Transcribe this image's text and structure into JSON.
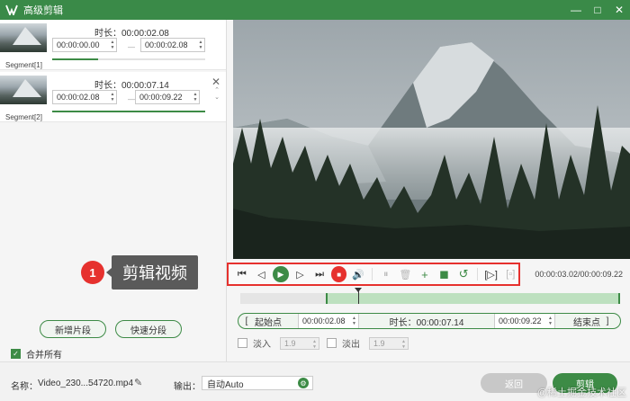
{
  "window": {
    "title": "高级剪辑",
    "minimize": "—",
    "maximize": "□",
    "close": "✕"
  },
  "segments": [
    {
      "label": "Segment[1]",
      "duration": "时长：00:00:02.08",
      "start": "00:00:00.00",
      "end": "00:00:02.08",
      "progress": 0.3,
      "dash": "—"
    },
    {
      "label": "Segment[2]",
      "duration": "时长：00:00:07.14",
      "start": "00:00:02.08",
      "end": "00:00:09.22",
      "progress": 1.0,
      "dash": "—",
      "close": "✕"
    }
  ],
  "annotation": {
    "number": "1",
    "text": "剪辑视频"
  },
  "left_buttons": {
    "add_segment": "新增片段",
    "quick_split": "快速分段"
  },
  "merge_all": {
    "label": "合并所有",
    "checked": true
  },
  "player": {
    "timecode": "00:00:03.02/00:00:09.22"
  },
  "range": {
    "start_label": "起始点",
    "start_value": "00:00:02.08",
    "duration": "时长：00:00:07.14",
    "end_value": "00:00:09.22",
    "end_label": "结束点",
    "bracket_left": "[",
    "bracket_right": "]"
  },
  "timeline": {
    "selection_start": 0.225,
    "playhead": 0.31
  },
  "fade_in": {
    "label": "淡入",
    "value": "1.9",
    "checked": false
  },
  "fade_out": {
    "label": "淡出",
    "value": "1.9",
    "checked": false
  },
  "bottom": {
    "name_label": "名称：",
    "filename": "Video_230...54720.mp4",
    "output_label": "输出：",
    "output_value": "自动Auto",
    "back_label": "返回",
    "cut_label": "剪辑"
  },
  "watermark": "@稀土掘金技术社区",
  "colors": {
    "accent": "#3d8b46",
    "highlight": "#e6312e",
    "titlebar": "#3a8a48"
  }
}
